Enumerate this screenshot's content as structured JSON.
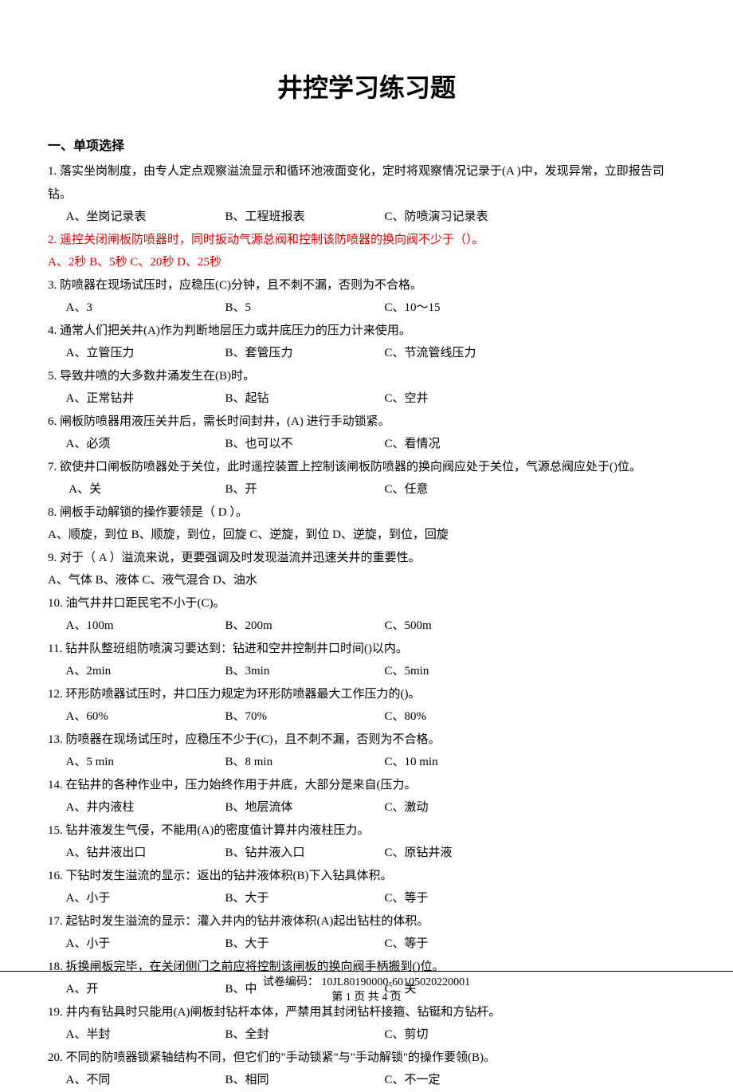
{
  "title": "井控学习练习题",
  "section1": "一、单项选择",
  "q1": {
    "text": "1. 落实坐岗制度，由专人定点观察溢流显示和循环池液面变化，定时将观察情况记录于(A )中，发现异常，立即报告司钻。",
    "a": "A、坐岗记录表",
    "b": "B、工程班报表",
    "c": "C、防喷演习记录表"
  },
  "q2": {
    "text": "2. 遥控关闭闸板防喷器时，同时扳动气源总阀和控制该防喷器的换向阀不少于（）。",
    "opts": "A、2秒   B、5秒   C、20秒   D、25秒"
  },
  "q3": {
    "text": "3. 防喷器在现场试压时，应稳压(C)分钟，且不刺不漏，否则为不合格。",
    "a": "A、3",
    "b": "B、5",
    "c": "C、10～15"
  },
  "q4": {
    "text": "4. 通常人们把关井(A)作为判断地层压力或井底压力的压力计来使用。",
    "a": "A、立管压力",
    "b": "B、套管压力",
    "c": "C、节流管线压力"
  },
  "q5": {
    "text": "5. 导致井喷的大多数井涌发生在(B)时。",
    "a": "A、正常钻井",
    "b": "B、起钻",
    "c": "C、空井"
  },
  "q6": {
    "text": "6. 闸板防喷器用液压关井后，需长时间封井，(A) 进行手动锁紧。",
    "a": "A、必须",
    "b": "B、也可以不",
    "c": "C、看情况"
  },
  "q7": {
    "text": "7. 欲使井口闸板防喷器处于关位，此时遥控装置上控制该闸板防喷器的换向阀应处于关位，气源总阀应处于()位。",
    "a": " A、关",
    "b": "B、开",
    "c": "C、任意"
  },
  "q8": {
    "text": "8. 闸板手动解锁的操作要领是（  D ）。",
    "opts": "A、顺旋，到位    B、顺旋，到位，回旋    C、逆旋，到位    D、逆旋，到位，回旋"
  },
  "q9": {
    "text": "9. 对于（ A ）溢流来说，更要强调及时发现溢流并迅速关井的重要性。",
    "opts": "A、气体   B、液体   C、液气混合    D、油水"
  },
  "q10": {
    "text": "10. 油气井井口距民宅不小于(C)。",
    "a": "A、100m",
    "b": "B、200m",
    "c": "C、500m"
  },
  "q11": {
    "text": "11. 钻井队整班组防喷演习要达到：钻进和空井控制井口时间()以内。",
    "a": "A、2min",
    "b": "B、3min",
    "c": "C、5min"
  },
  "q12": {
    "text": "12. 环形防喷器试压时，井口压力规定为环形防喷器最大工作压力的()。",
    "a": "A、60%",
    "b": "B、70%",
    "c": "C、80%"
  },
  "q13": {
    "text": "13. 防喷器在现场试压时，应稳压不少于(C)，且不刺不漏，否则为不合格。",
    "a": "A、5 min",
    "b": "B、8 min",
    "c": "C、10 min"
  },
  "q14": {
    "text": "14. 在钻井的各种作业中，压力始终作用于井底，大部分是来自(压力。",
    "a": "A、井内液柱",
    "b": "B、地层流体",
    "c": "C、激动"
  },
  "q15": {
    "text": "15. 钻井液发生气侵，不能用(A)的密度值计算井内液柱压力。",
    "a": "A、钻井液出口",
    "b": "B、钻井液入口",
    "c": "C、原钻井液"
  },
  "q16": {
    "text": "16. 下钻时发生溢流的显示：返出的钻井液体积(B)下入钻具体积。",
    "a": "A、小于",
    "b": "B、大于",
    "c": "C、等于"
  },
  "q17": {
    "text": "17. 起钻时发生溢流的显示：灌入井内的钻井液体积(A)起出钻柱的体积。",
    "a": "A、小于",
    "b": "B、大于",
    "c": "C、等于"
  },
  "q18": {
    "text": "18. 拆换闸板完毕，在关闭侧门之前应将控制该闸板的换向阀手柄搬到()位。",
    "a": "A、开",
    "b": "B、中",
    "c": "C、关"
  },
  "q19": {
    "text": "19. 井内有钻具时只能用(A)闸板封钻杆本体，严禁用其封闭钻杆接箍、钻铤和方钻杆。",
    "a": "A、半封",
    "b": "B、全封",
    "c": "C、剪切"
  },
  "q20": {
    "text": "20. 不同的防喷器锁紧轴结构不同，但它们的\"手动锁紧\"与\"手动解锁\"的操作要领(B)。",
    "a": "A、不同",
    "b": "B、相同",
    "c": "C、不一定"
  },
  "footer": {
    "line1": "试卷编码： 10JL80190000-60105020220001",
    "line2": "第 1 页   共 4 页"
  }
}
